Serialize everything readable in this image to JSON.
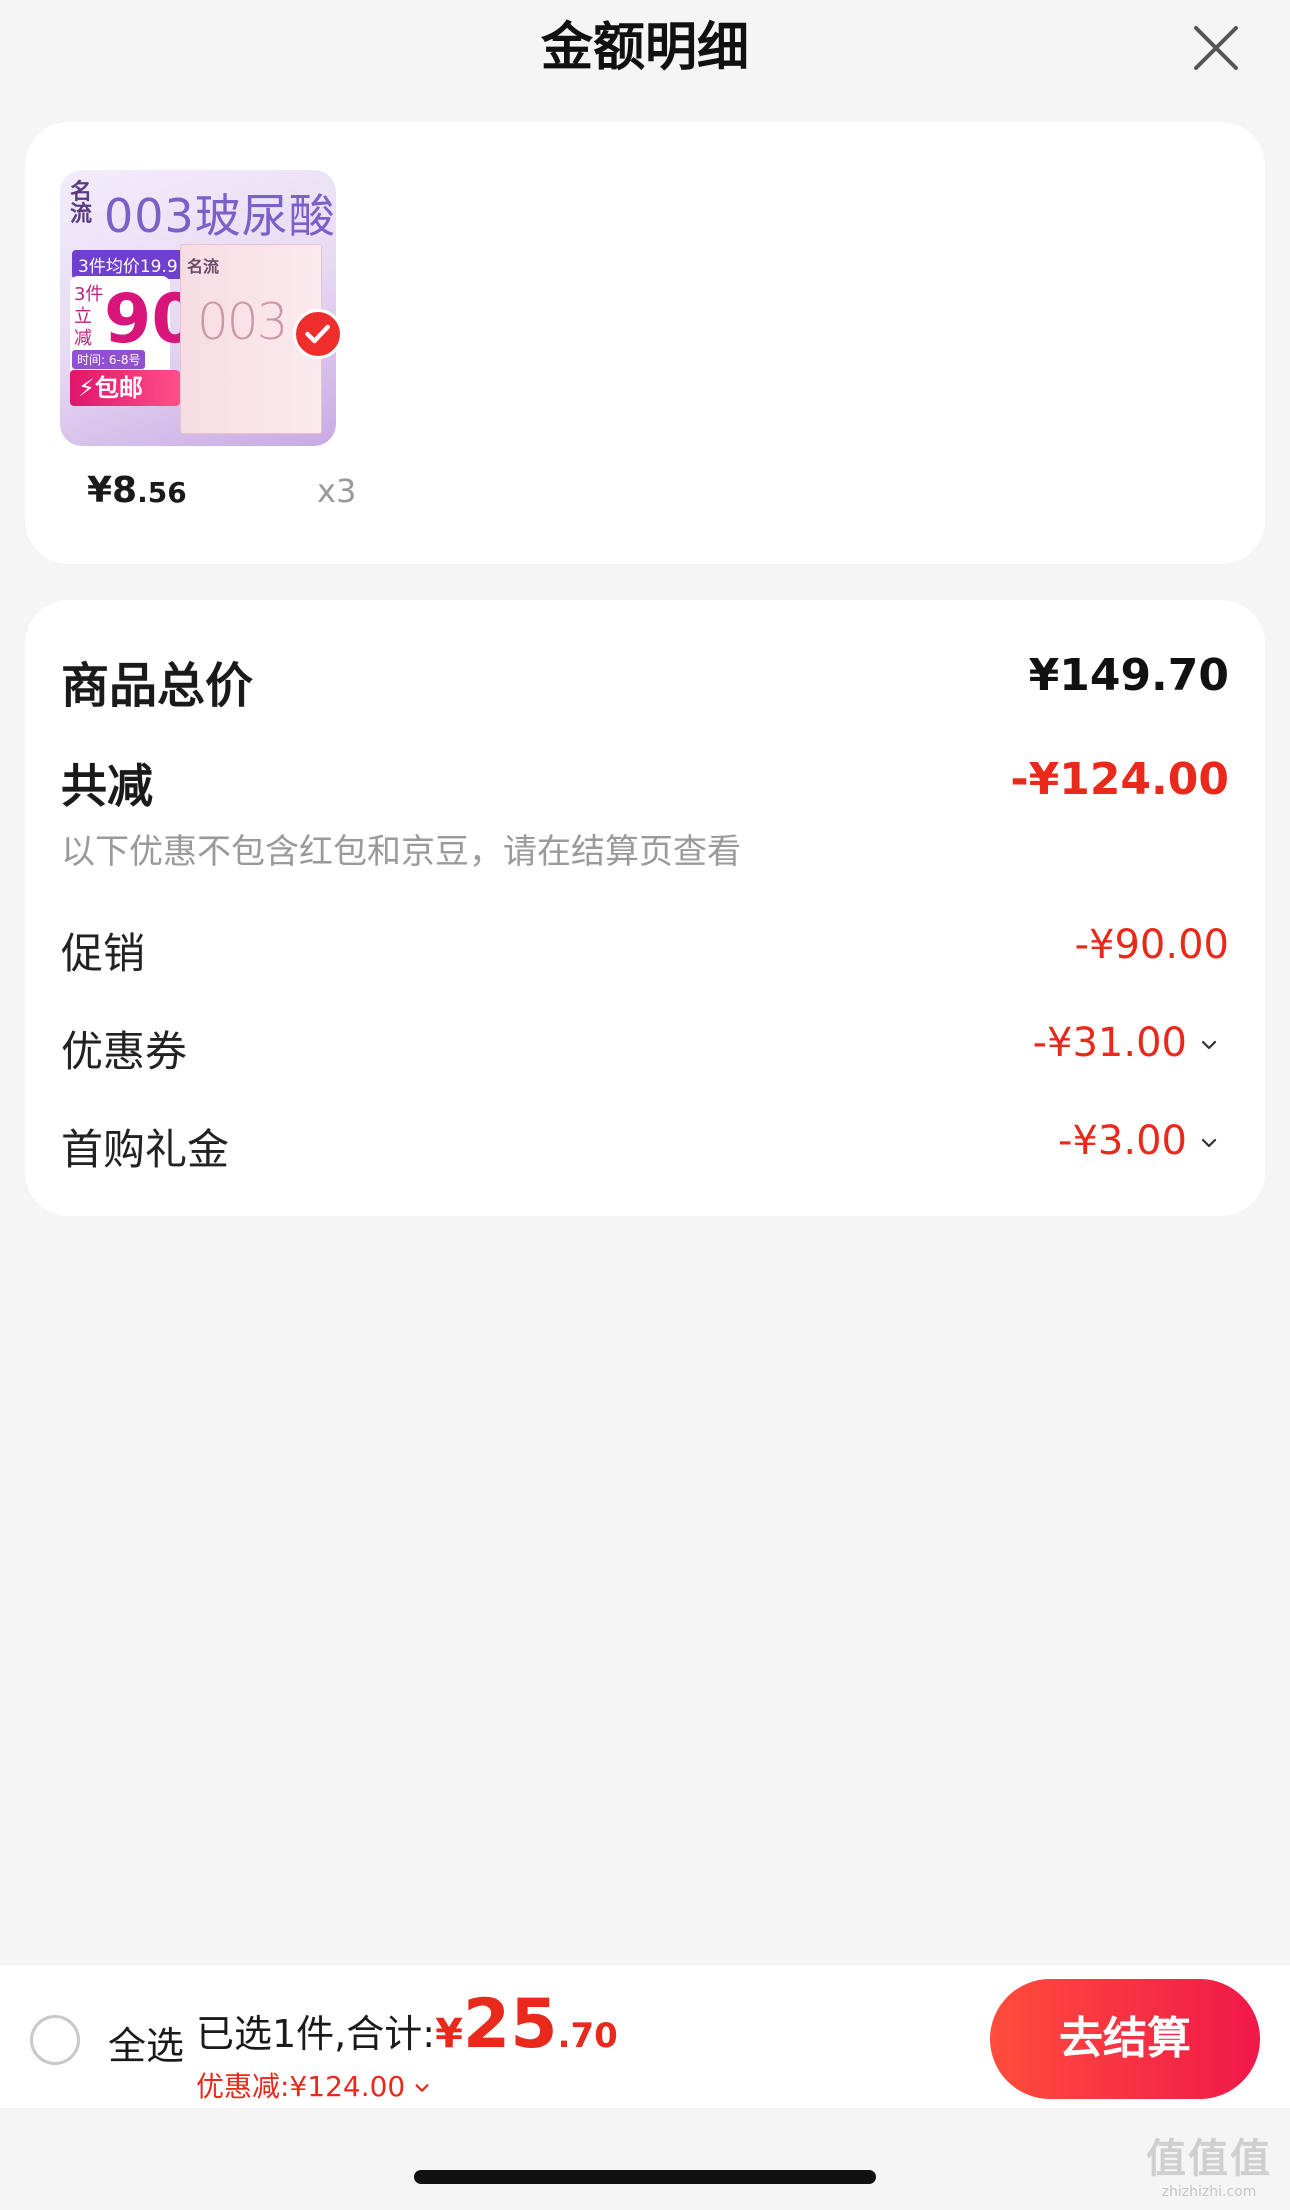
{
  "header": {
    "title": "金额明细",
    "close_icon": "close-icon"
  },
  "product": {
    "thumbnail": {
      "brand": "名流",
      "title": "003玻尿酸",
      "promo_tag": "3件均价19.9",
      "promo_text": "3件立减",
      "promo_number": "90",
      "promo_date": "时间: 6-8号",
      "promo_shipping": "包邮",
      "box_brand": "名流",
      "box_number": "003"
    },
    "price_main": "¥8",
    "price_cents": ".56",
    "quantity": "x3",
    "selected": true
  },
  "summary": {
    "total_label": "商品总价",
    "total_value": "¥149.70",
    "discount_label": "共减",
    "discount_value": "-¥124.00",
    "note": "以下优惠不包含红包和京豆，请在结算页查看",
    "items": [
      {
        "label": "促销",
        "value": "-¥90.00"
      },
      {
        "label": "优惠券",
        "value": "-¥31.00"
      },
      {
        "label": "首购礼金",
        "value": "-¥3.00"
      }
    ]
  },
  "bottom": {
    "select_all": "全选",
    "selected_text": "已选1件,合计:",
    "currency": "¥",
    "total_int": "25",
    "total_dec": ".70",
    "savings": "优惠减:¥124.00",
    "checkout": "去结算"
  },
  "watermark": {
    "logo": "值值值",
    "url": "zhizhizhi.com"
  },
  "colors": {
    "accent_red": "#e8291b",
    "checkout_gradient_start": "#ff4d3b",
    "checkout_gradient_end": "#f0184a",
    "background": "#f5f5f5"
  }
}
